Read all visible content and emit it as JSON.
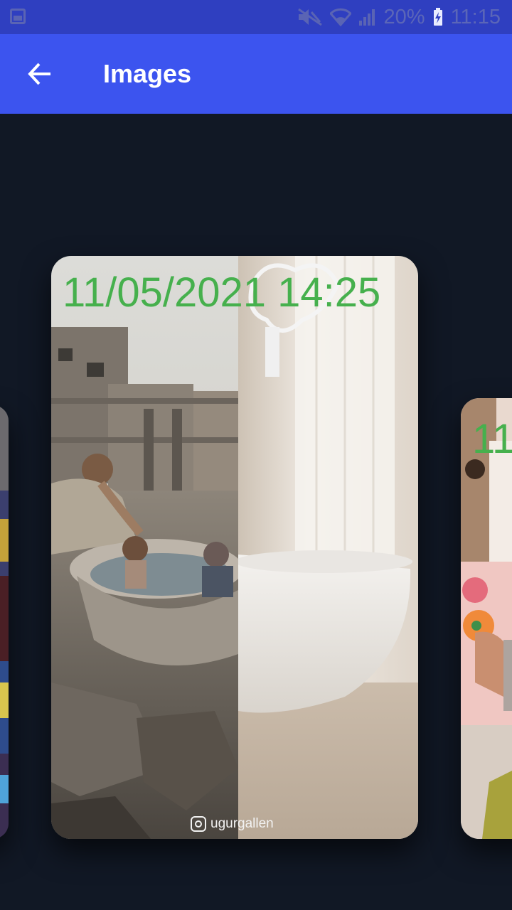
{
  "status_bar": {
    "battery_percent": "20%",
    "time": "11:15",
    "icons": [
      "gallery-icon",
      "mute-icon",
      "wifi-icon",
      "signal-icon",
      "battery-charging-icon"
    ]
  },
  "app_bar": {
    "title": "Images",
    "back_icon": "arrow-back-icon",
    "color": "#3c54ef"
  },
  "carousel": {
    "current": {
      "timestamp": "11/05/2021 14:25",
      "watermark": "ugurgallen"
    },
    "next": {
      "timestamp": "11"
    }
  },
  "colors": {
    "background": "#111825",
    "timestamp": "#46b04d"
  }
}
